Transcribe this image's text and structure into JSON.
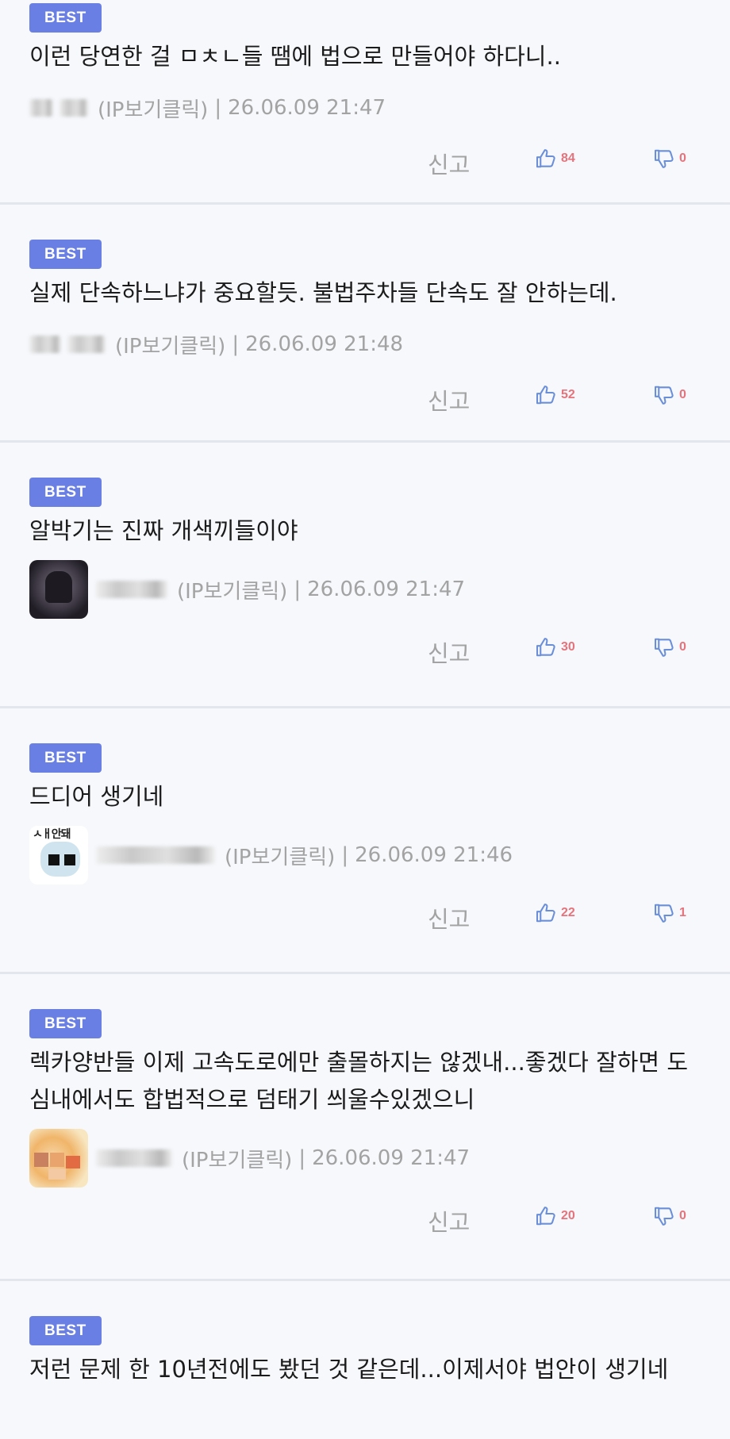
{
  "comments": [
    {
      "badge": "BEST",
      "text": "이런 당연한 걸 ㅁㅊㄴ들 땜에 법으로 만들어야 하다니..",
      "ip_label": "(IP보기클릭)",
      "separator": "|",
      "date": "26.06.09 21:47",
      "report_label": "신고",
      "likes": "84",
      "dislikes": "0"
    },
    {
      "badge": "BEST",
      "text": "실제 단속하느냐가 중요할듯. 불법주차들 단속도 잘 안하는데.",
      "ip_label": "(IP보기클릭)",
      "separator": "|",
      "date": "26.06.09 21:48",
      "report_label": "신고",
      "likes": "52",
      "dislikes": "0"
    },
    {
      "badge": "BEST",
      "text": "알박기는 진짜 개색끼들이야",
      "ip_label": "(IP보기클릭)",
      "separator": "|",
      "date": "26.06.09 21:47",
      "report_label": "신고",
      "likes": "30",
      "dislikes": "0"
    },
    {
      "badge": "BEST",
      "text": "드디어 생기네",
      "ip_label": "(IP보기클릭)",
      "separator": "|",
      "date": "26.06.09 21:46",
      "report_label": "신고",
      "likes": "22",
      "dislikes": "1"
    },
    {
      "badge": "BEST",
      "text": "렉카양반들 이제 고속도로에만 출몰하지는 않겠내...좋겠다 잘하면 도심내에서도 합법적으로 덤태기 씌울수있겠으니",
      "ip_label": "(IP보기클릭)",
      "separator": "|",
      "date": "26.06.09 21:47",
      "report_label": "신고",
      "likes": "20",
      "dislikes": "0"
    },
    {
      "badge": "BEST",
      "text": "저런 문제 한 10년전에도 봤던 것 같은데...이제서야 법안이 생기네"
    }
  ],
  "icons": {
    "thumb_up": "thumb-up-outline-icon",
    "thumb_down": "thumb-down-outline-icon"
  },
  "colors": {
    "badge_bg": "#6a7fe3",
    "count": "#e6737b",
    "thumb": "#6a8fd8",
    "meta": "#a3a3a3",
    "background": "#f6f8fc"
  }
}
